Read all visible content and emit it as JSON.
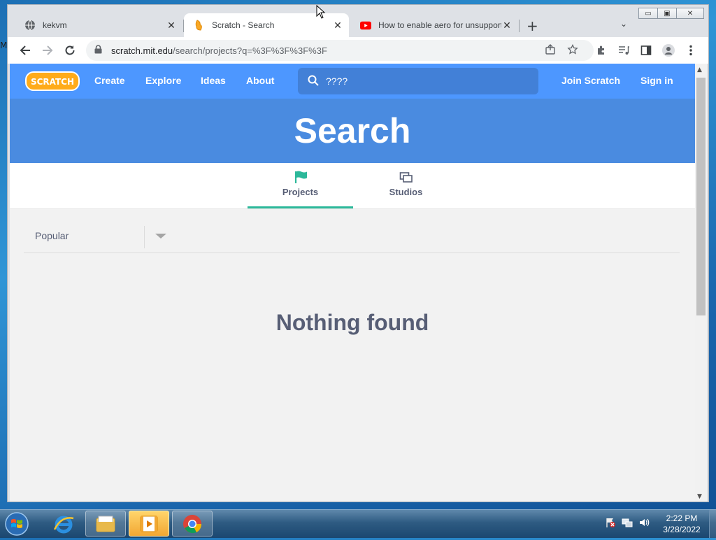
{
  "desktop": {
    "edge_text": "M"
  },
  "window": {
    "controls": {
      "minimize": "▭",
      "maximize": "▣",
      "close": "✕"
    }
  },
  "tabs": [
    {
      "title": "kekvm",
      "icon": "globe-icon",
      "close": "✕"
    },
    {
      "title": "Scratch - Search",
      "icon": "scratch-cat-icon",
      "close": "✕"
    },
    {
      "title": "How to enable aero for unsupported",
      "icon": "youtube-icon",
      "close": "✕"
    }
  ],
  "toolbar": {
    "new_tab": "+",
    "tab_search": "⌄",
    "url_host": "scratch.mit.edu",
    "url_path": "/search/projects?q=%3F%3F%3F%3F"
  },
  "scratch": {
    "logo": "SCRATCH",
    "nav": {
      "create": "Create",
      "explore": "Explore",
      "ideas": "Ideas",
      "about": "About"
    },
    "search_value": "????",
    "join": "Join Scratch",
    "signin": "Sign in",
    "hero_title": "Search",
    "tabs": {
      "projects": "Projects",
      "studios": "Studios"
    },
    "sort": "Popular",
    "empty": "Nothing found",
    "accent_color": "#4d97ff",
    "active_tab_color": "#2cb89a"
  },
  "taskbar": {
    "time": "2:22 PM",
    "date": "3/28/2022"
  }
}
